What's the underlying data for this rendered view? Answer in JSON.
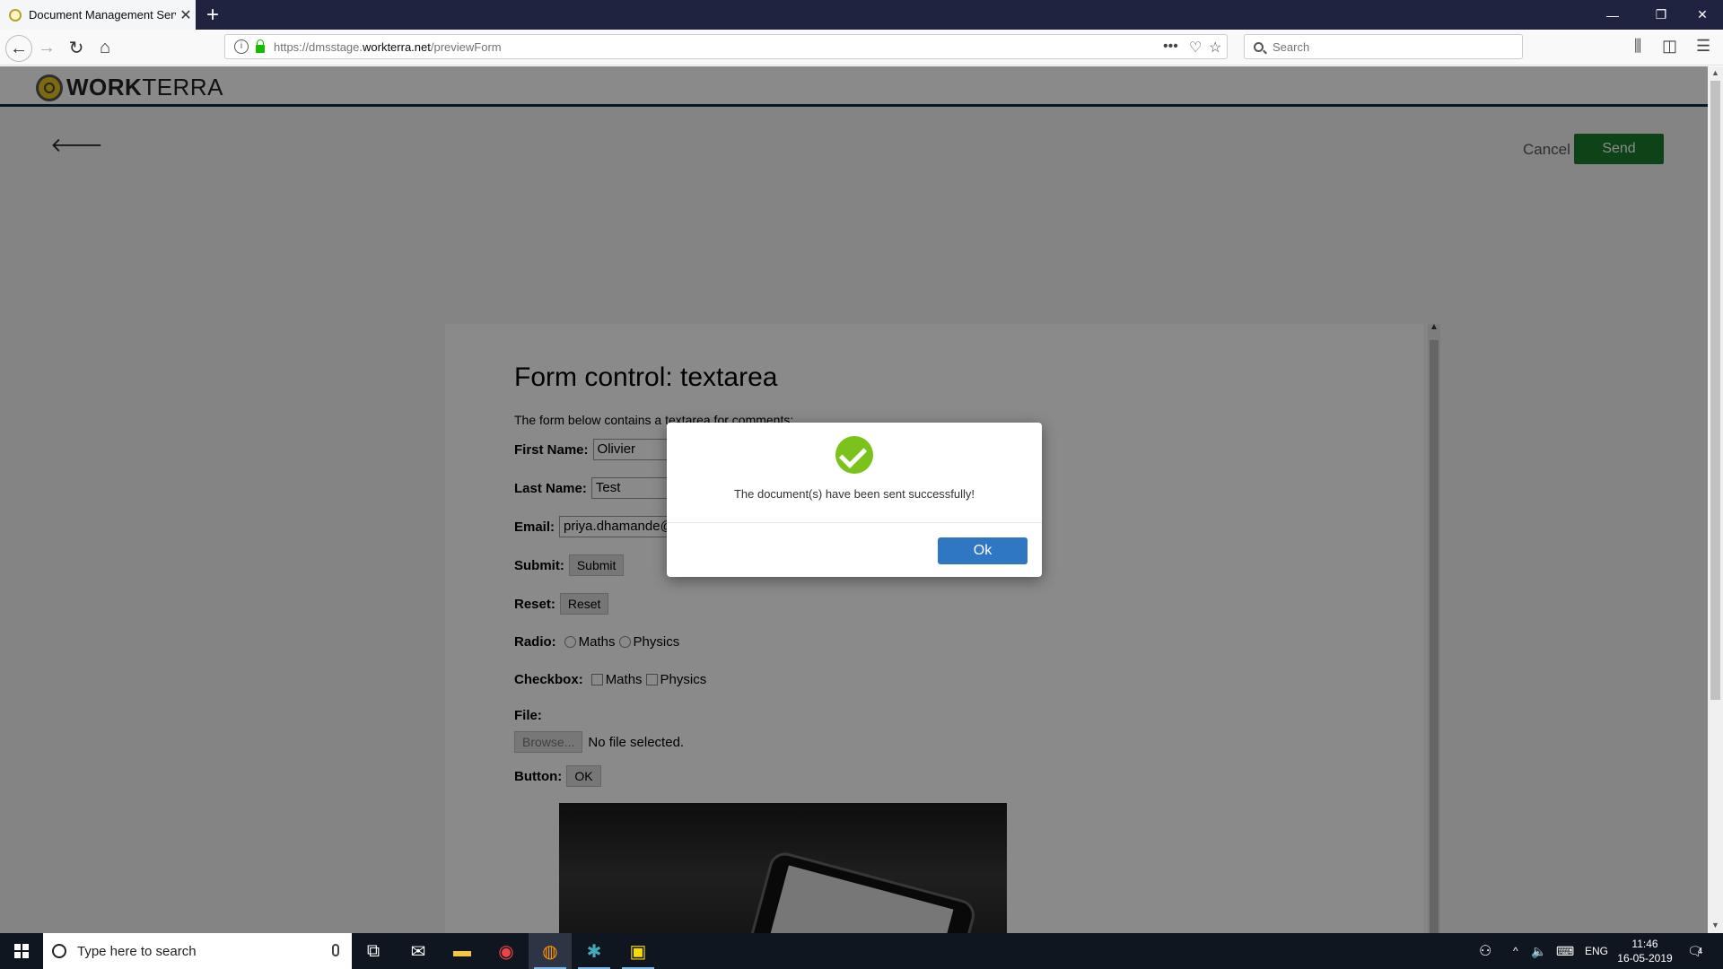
{
  "browser": {
    "tab_title": "Document Management Servic",
    "url_host_pre": "https://dmsstage.",
    "url_host": "workterra.net",
    "url_path": "/previewForm",
    "search_placeholder": "Search"
  },
  "app": {
    "logo_bold": "WORK",
    "logo_light": "TERRA",
    "cancel_label": "Cancel",
    "send_label": "Send",
    "send_color": "#1b7a2c"
  },
  "form": {
    "title": "Form control: textarea",
    "intro": "The form below contains a textarea for comments:",
    "first_name_label": "First Name:",
    "first_name_value": "Olivier",
    "last_name_label": "Last Name:",
    "last_name_value": "Test",
    "email_label": "Email:",
    "email_value": "priya.dhamande@h",
    "submit_label": "Submit:",
    "submit_button": "Submit",
    "reset_label": "Reset:",
    "reset_button": "Reset",
    "radio_label": "Radio:",
    "radio_opt1": "Maths",
    "radio_opt2": "Physics",
    "checkbox_label": "Checkbox:",
    "checkbox_opt1": "Maths",
    "checkbox_opt2": "Physics",
    "file_label": "File:",
    "browse_button": "Browse...",
    "file_status": "No file selected.",
    "button_label": "Button:",
    "ok_button": "OK"
  },
  "modal": {
    "message": "The document(s) have been sent successfully!",
    "ok_label": "Ok",
    "ok_color": "#2f77c2"
  },
  "taskbar": {
    "search_placeholder": "Type here to search",
    "lang": "ENG",
    "time": "11:46",
    "date": "16-05-2019",
    "notifications": "4"
  }
}
